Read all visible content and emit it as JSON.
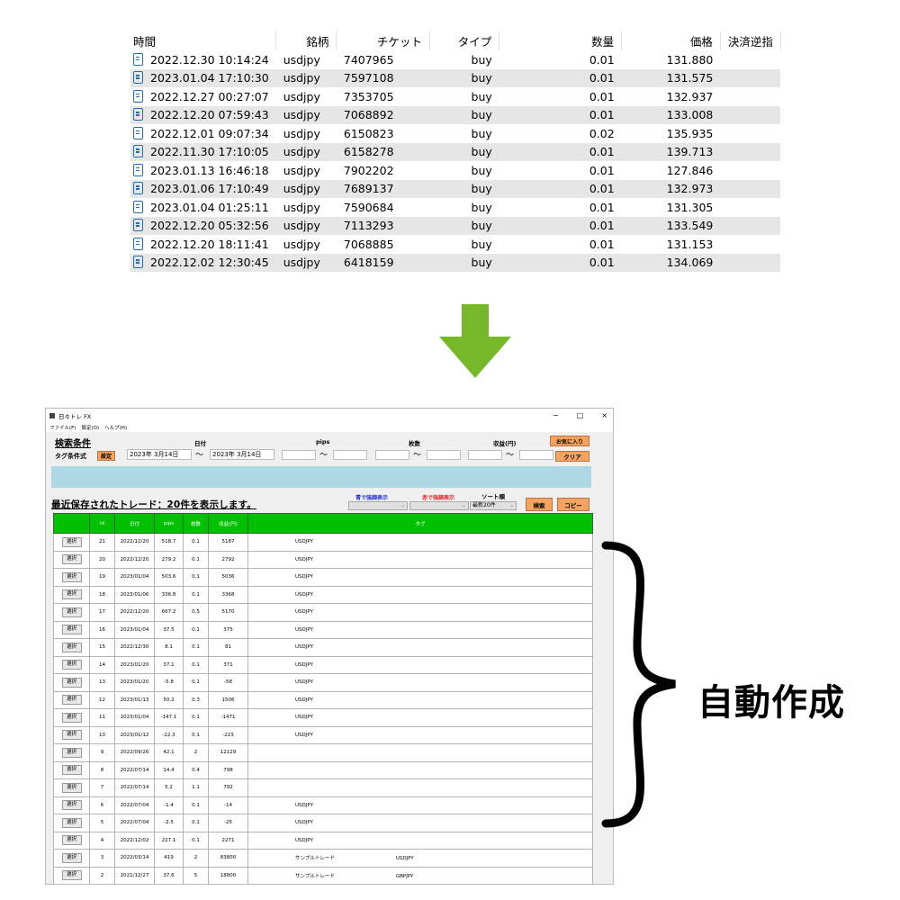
{
  "top_table": {
    "headers": [
      "時間",
      "銘柄",
      "チケット",
      "タイプ",
      "数量",
      "価格",
      "決済逆指"
    ],
    "rows": [
      {
        "time": "2022.12.30 10:14:24",
        "symbol": "usdjpy",
        "ticket": "7407965",
        "type": "buy",
        "volume": "0.01",
        "price": "131.880"
      },
      {
        "time": "2023.01.04 17:10:30",
        "symbol": "usdjpy",
        "ticket": "7597108",
        "type": "buy",
        "volume": "0.01",
        "price": "131.575"
      },
      {
        "time": "2022.12.27 00:27:07",
        "symbol": "usdjpy",
        "ticket": "7353705",
        "type": "buy",
        "volume": "0.01",
        "price": "132.937"
      },
      {
        "time": "2022.12.20 07:59:43",
        "symbol": "usdjpy",
        "ticket": "7068892",
        "type": "buy",
        "volume": "0.01",
        "price": "133.008"
      },
      {
        "time": "2022.12.01 09:07:34",
        "symbol": "usdjpy",
        "ticket": "6150823",
        "type": "buy",
        "volume": "0.02",
        "price": "135.935"
      },
      {
        "time": "2022.11.30 17:10:05",
        "symbol": "usdjpy",
        "ticket": "6158278",
        "type": "buy",
        "volume": "0.01",
        "price": "139.713"
      },
      {
        "time": "2023.01.13 16:46:18",
        "symbol": "usdjpy",
        "ticket": "7902202",
        "type": "buy",
        "volume": "0.01",
        "price": "127.846"
      },
      {
        "time": "2023.01.06 17:10:49",
        "symbol": "usdjpy",
        "ticket": "7689137",
        "type": "buy",
        "volume": "0.01",
        "price": "132.973"
      },
      {
        "time": "2023.01.04 01:25:11",
        "symbol": "usdjpy",
        "ticket": "7590684",
        "type": "buy",
        "volume": "0.01",
        "price": "131.305"
      },
      {
        "time": "2022.12.20 05:32:56",
        "symbol": "usdjpy",
        "ticket": "7113293",
        "type": "buy",
        "volume": "0.01",
        "price": "133.549"
      },
      {
        "time": "2022.12.20 18:11:41",
        "symbol": "usdjpy",
        "ticket": "7068885",
        "type": "buy",
        "volume": "0.01",
        "price": "131.153"
      },
      {
        "time": "2022.12.02 12:30:45",
        "symbol": "usdjpy",
        "ticket": "6418159",
        "type": "buy",
        "volume": "0.01",
        "price": "134.069"
      }
    ]
  },
  "arrow": {
    "icon": "down-arrow-icon",
    "color": "#76b82a"
  },
  "app": {
    "title": "日々トレ FX",
    "window_controls": [
      "−",
      "□",
      "×"
    ],
    "menu": [
      "ファイル(F)",
      "設定(O)",
      "ヘルプ(H)"
    ],
    "search_heading": "検索条件",
    "tag_condition_label": "タグ条件式",
    "set_button": "設定",
    "date_label": "日付",
    "date_from": "2023年 3月14日",
    "date_to": "2023年 3月14日",
    "tilde": "〜",
    "pips_label": "pips",
    "lots_label": "枚数",
    "profit_label": "収益(円)",
    "favorite_button": "お気に入り",
    "clear_button": "クリア",
    "recent_title": "最近保存されたトレード：20件を表示します。",
    "blue_highlight_label": "青で強調表示",
    "red_highlight_label": "赤で強調表示",
    "sort_label": "ソート順",
    "sort_value": "最新20件",
    "search_button": "検索",
    "copy_button": "コピー",
    "grid_headers": [
      "",
      "id",
      "日付",
      "pips",
      "枚数",
      "収益(円)",
      "タグ"
    ],
    "select_label": "選択",
    "rows": [
      {
        "id": "21",
        "date": "2022/12/20",
        "pips": "518.7",
        "lots": "0.1",
        "profit": "5187",
        "tag": "USDJPY",
        "tag2": ""
      },
      {
        "id": "20",
        "date": "2022/12/20",
        "pips": "279.2",
        "lots": "0.1",
        "profit": "2792",
        "tag": "USDJPY",
        "tag2": ""
      },
      {
        "id": "19",
        "date": "2023/01/04",
        "pips": "503.6",
        "lots": "0.1",
        "profit": "5036",
        "tag": "USDJPY",
        "tag2": ""
      },
      {
        "id": "18",
        "date": "2023/01/06",
        "pips": "336.8",
        "lots": "0.1",
        "profit": "3368",
        "tag": "USDJPY",
        "tag2": ""
      },
      {
        "id": "17",
        "date": "2022/12/20",
        "pips": "667.2",
        "lots": "0.5",
        "profit": "5170",
        "tag": "USDJPY",
        "tag2": ""
      },
      {
        "id": "16",
        "date": "2023/01/04",
        "pips": "37.5",
        "lots": "0.1",
        "profit": "375",
        "tag": "USDJPY",
        "tag2": ""
      },
      {
        "id": "15",
        "date": "2022/12/30",
        "pips": "8.1",
        "lots": "0.1",
        "profit": "81",
        "tag": "USDJPY",
        "tag2": ""
      },
      {
        "id": "14",
        "date": "2023/01/20",
        "pips": "37.1",
        "lots": "0.1",
        "profit": "371",
        "tag": "USDJPY",
        "tag2": ""
      },
      {
        "id": "13",
        "date": "2023/01/20",
        "pips": "-5.8",
        "lots": "0.1",
        "profit": "-58",
        "tag": "USDJPY",
        "tag2": ""
      },
      {
        "id": "12",
        "date": "2023/01/13",
        "pips": "50.2",
        "lots": "0.3",
        "profit": "1506",
        "tag": "USDJPY",
        "tag2": ""
      },
      {
        "id": "11",
        "date": "2023/01/04",
        "pips": "-147.1",
        "lots": "0.1",
        "profit": "-1471",
        "tag": "USDJPY",
        "tag2": ""
      },
      {
        "id": "10",
        "date": "2023/01/12",
        "pips": "-22.3",
        "lots": "0.1",
        "profit": "-223",
        "tag": "USDJPY",
        "tag2": ""
      },
      {
        "id": "9",
        "date": "2022/09/26",
        "pips": "42.1",
        "lots": "2",
        "profit": "12129",
        "tag": "",
        "tag2": ""
      },
      {
        "id": "8",
        "date": "2022/07/14",
        "pips": "14.4",
        "lots": "0.4",
        "profit": "798",
        "tag": "",
        "tag2": ""
      },
      {
        "id": "7",
        "date": "2022/07/14",
        "pips": "5.2",
        "lots": "1.1",
        "profit": "792",
        "tag": "",
        "tag2": ""
      },
      {
        "id": "6",
        "date": "2022/07/04",
        "pips": "-1.4",
        "lots": "0.1",
        "profit": "-14",
        "tag": "USDJPY",
        "tag2": ""
      },
      {
        "id": "5",
        "date": "2022/07/04",
        "pips": "-2.5",
        "lots": "0.1",
        "profit": "-25",
        "tag": "USDJPY",
        "tag2": ""
      },
      {
        "id": "4",
        "date": "2022/12/02",
        "pips": "227.1",
        "lots": "0.1",
        "profit": "2271",
        "tag": "USDJPY",
        "tag2": ""
      },
      {
        "id": "3",
        "date": "2022/03/14",
        "pips": "419",
        "lots": "2",
        "profit": "83800",
        "tag": "サンプルトレード",
        "tag2": "USDJPY"
      },
      {
        "id": "2",
        "date": "2021/12/27",
        "pips": "37.6",
        "lots": "5",
        "profit": "18800",
        "tag": "サンプルトレード",
        "tag2": "GBPJPY"
      }
    ]
  },
  "brace": {
    "icon": "right-curly-brace-icon"
  },
  "caption": "自動作成"
}
